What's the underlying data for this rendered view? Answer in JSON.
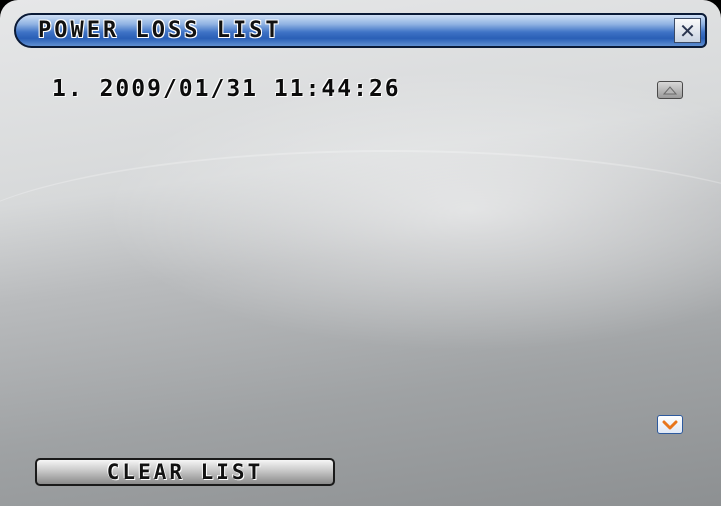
{
  "dialog": {
    "title": "POWER LOSS LIST",
    "close_icon": "close-icon"
  },
  "entries": [
    {
      "index": "1.",
      "timestamp": "2009/01/31 11:44:26"
    }
  ],
  "scroll": {
    "up_icon": "chevron-up-icon",
    "down_icon": "chevron-down-icon",
    "down_accent": "#e8761c"
  },
  "buttons": {
    "clear_label": "CLEAR LIST"
  }
}
